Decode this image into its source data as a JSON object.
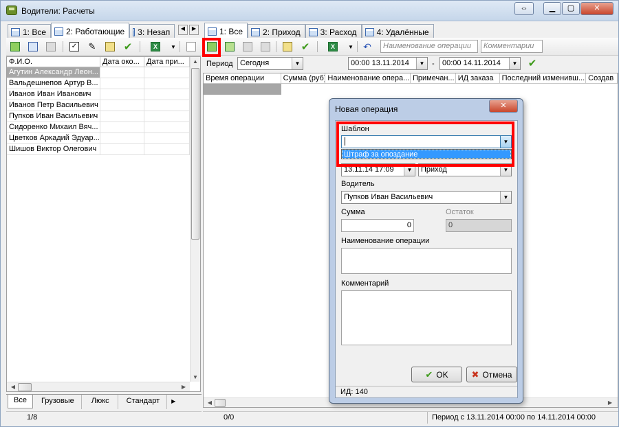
{
  "window": {
    "title": "Водители: Расчеты"
  },
  "left": {
    "tabs": [
      "1: Все",
      "2: Работающие",
      "3: Незап"
    ],
    "columns": [
      "Ф.И.О.",
      "Дата око...",
      "Дата при..."
    ],
    "rows": [
      "Агутин Александр Леон...",
      "Вальдешнепов Артур В...",
      "Иванов Иван Иванович",
      "Иванов Петр Васильевич",
      "Пупков Иван Васильевич",
      "Сидоренко Михаил Вяч...",
      "Цветков Аркадий Эдуар...",
      "Шишов Виктор Олегович"
    ],
    "bottom_tabs": [
      "Все",
      "Грузовые",
      "Люкс",
      "Стандарт"
    ],
    "status": "1/8"
  },
  "right": {
    "tabs": [
      "1: Все",
      "2: Приход",
      "3: Расход",
      "4: Удалённые"
    ],
    "filter_name_placeholder": "Наименование операции",
    "filter_comment_placeholder": "Комментарии",
    "period_label": "Период",
    "period_value": "Сегодня",
    "date_from": "00:00 13.11.2014",
    "date_sep": "-",
    "date_to": "00:00 14.11.2014",
    "columns": [
      "Время операции",
      "Сумма (руб)",
      "Наименование опера...",
      "Примечан...",
      "ИД заказа",
      "Последний изменивш...",
      "Создав"
    ],
    "status_count": "0/0",
    "status_period": "Период с 13.11.2014 00:00 по 14.11.2014 00:00"
  },
  "dialog": {
    "title": "Новая операция",
    "template_label": "Шаблон",
    "template_value": "",
    "template_option": "Штраф за опоздание",
    "datetime_value": "13.11.14 17:09",
    "type_value": "Приход",
    "driver_label": "Водитель",
    "driver_value": "Пупков Иван Васильевич",
    "sum_label": "Сумма",
    "sum_value": "0",
    "balance_label": "Остаток",
    "balance_value": "0",
    "name_label": "Наименование операции",
    "comment_label": "Комментарий",
    "ok_label": "OK",
    "cancel_label": "Отмена",
    "id_text": "ИД: 140"
  },
  "colors": {
    "highlight_red": "#ff0000",
    "selection": "#3399ff",
    "title_bar": "#c5d6ea"
  }
}
